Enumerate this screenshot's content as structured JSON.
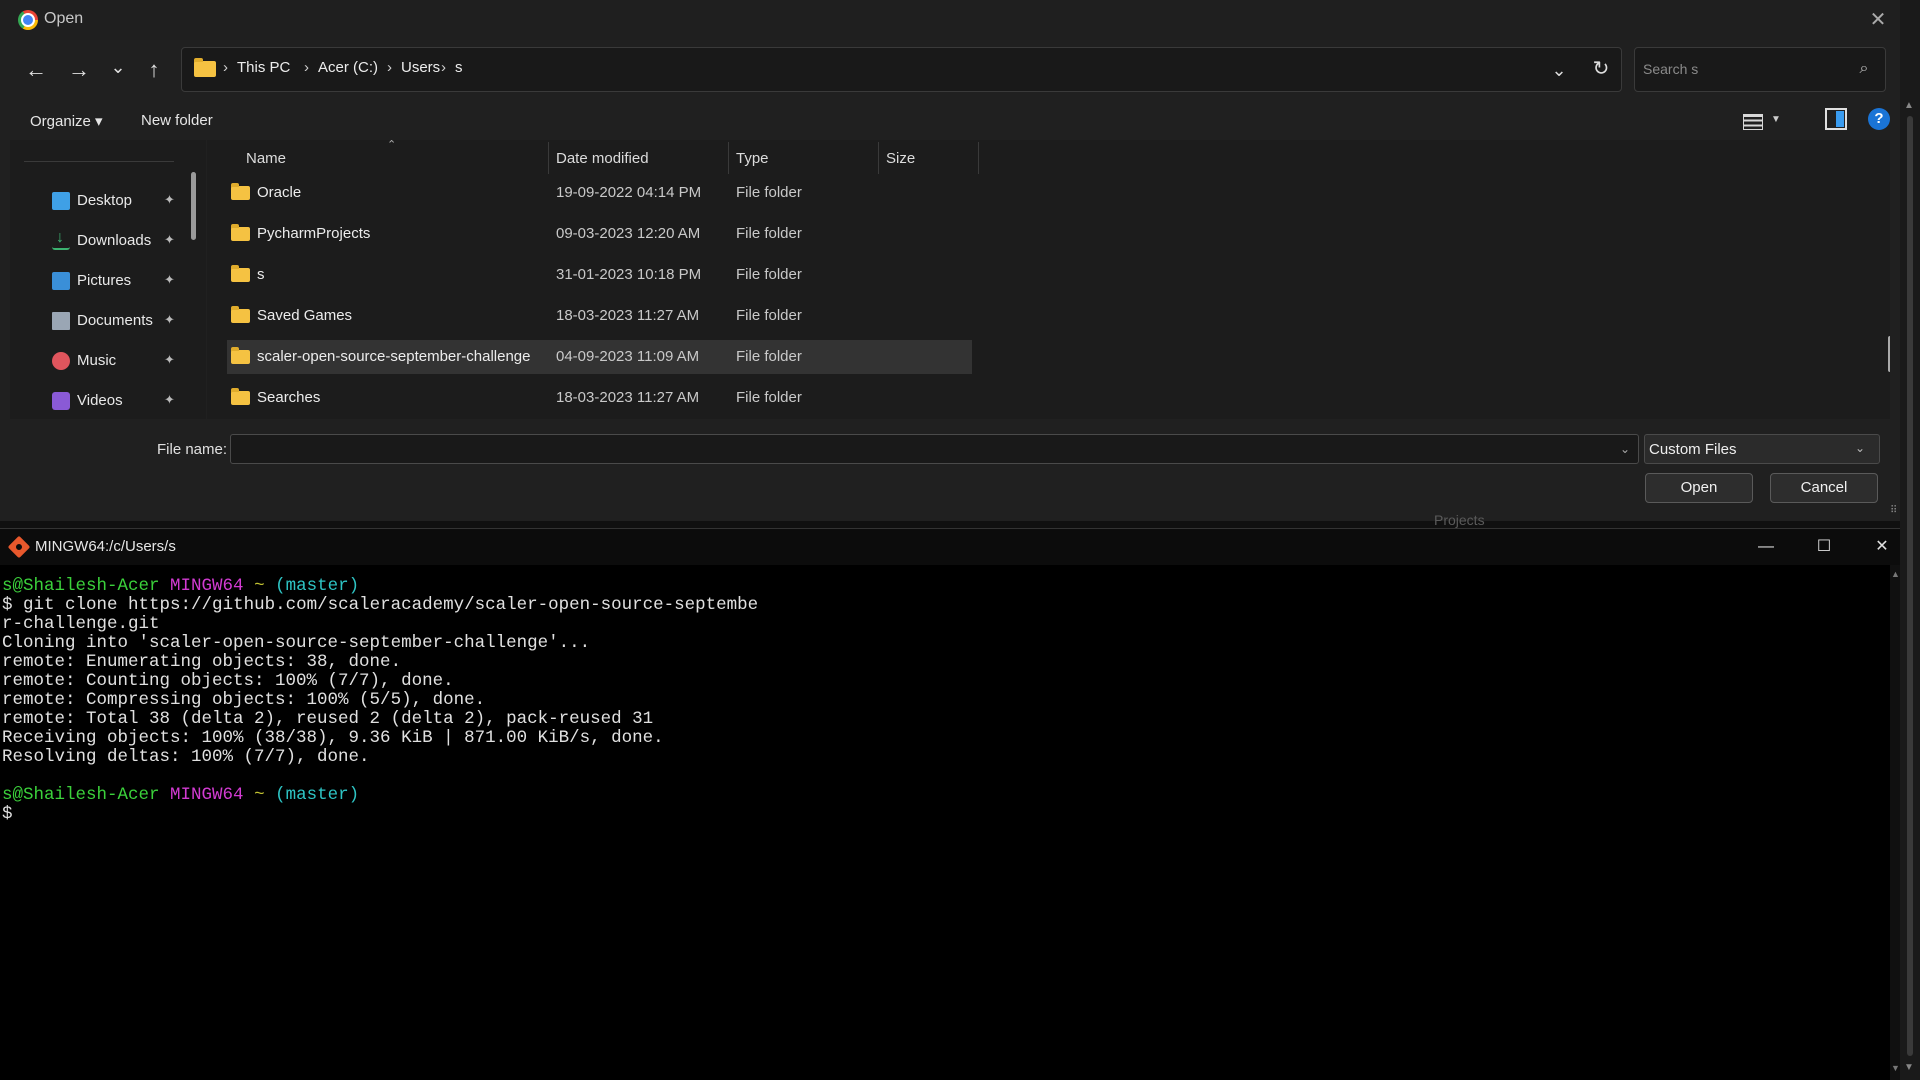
{
  "dialog": {
    "title": "Open",
    "close_glyph": "✕",
    "nav": {
      "back_glyph": "←",
      "forward_glyph": "→",
      "recent_glyph": "⌄",
      "up_glyph": "↑"
    },
    "address": {
      "breadcrumbs": [
        "This PC",
        "Acer (C:)",
        "Users",
        "s"
      ],
      "separator": "›",
      "dropdown_glyph": "⌄",
      "refresh_glyph": "↻"
    },
    "search": {
      "placeholder": "Search s",
      "icon_glyph": "⌕"
    },
    "toolbar": {
      "organize_label": "Organize ▾",
      "new_folder_label": "New folder",
      "help_label": "?"
    },
    "nav_pane": {
      "pin_glyph": "📌",
      "items": [
        {
          "label": "Desktop",
          "icon": "desktop-icon",
          "color": "#3fa0e6"
        },
        {
          "label": "Downloads",
          "icon": "download-icon",
          "color": "#3cb371"
        },
        {
          "label": "Pictures",
          "icon": "pictures-icon",
          "color": "#3a8fd8"
        },
        {
          "label": "Documents",
          "icon": "documents-icon",
          "color": "#9aa6b4"
        },
        {
          "label": "Music",
          "icon": "music-icon",
          "color": "#e0555d"
        },
        {
          "label": "Videos",
          "icon": "videos-icon",
          "color": "#8a5ad6"
        }
      ]
    },
    "columns": {
      "name": "Name",
      "date": "Date modified",
      "type": "Type",
      "size": "Size"
    },
    "sort_glyph": "⌃",
    "files": [
      {
        "name": "Oracle",
        "date": "19-09-2022 04:14 PM",
        "type": "File folder",
        "selected": false
      },
      {
        "name": "PycharmProjects",
        "date": "09-03-2023 12:20 AM",
        "type": "File folder",
        "selected": false
      },
      {
        "name": "s",
        "date": "31-01-2023 10:18 PM",
        "type": "File folder",
        "selected": false
      },
      {
        "name": "Saved Games",
        "date": "18-03-2023 11:27 AM",
        "type": "File folder",
        "selected": false
      },
      {
        "name": "scaler-open-source-september-challenge",
        "date": "04-09-2023 11:09 AM",
        "type": "File folder",
        "selected": true
      },
      {
        "name": "Searches",
        "date": "18-03-2023 11:27 AM",
        "type": "File folder",
        "selected": false
      }
    ],
    "filename": {
      "label": "File name:",
      "value": "",
      "dropdown_glyph": "⌄"
    },
    "filetype": {
      "value": "Custom Files",
      "caret_glyph": "⌄"
    },
    "buttons": {
      "open": "Open",
      "cancel": "Cancel"
    },
    "behind_window_text": "Projects"
  },
  "terminal": {
    "title": "MINGW64:/c/Users/s",
    "controls": {
      "minimize": "—",
      "maximize": "☐",
      "close": "✕"
    },
    "prompt": {
      "user": "s@Shailesh-Acer",
      "env": "MINGW64",
      "path": "~",
      "branch": "(master)",
      "symbol": "$"
    },
    "command": "git clone https://github.com/scaleracademy/scaler-open-source-septembe",
    "command_wrap": "r-challenge.git",
    "output": [
      "Cloning into 'scaler-open-source-september-challenge'...",
      "remote: Enumerating objects: 38, done.",
      "remote: Counting objects: 100% (7/7), done.",
      "remote: Compressing objects: 100% (5/5), done.",
      "remote: Total 38 (delta 2), reused 2 (delta 2), pack-reused 31",
      "Receiving objects: 100% (38/38), 9.36 KiB | 871.00 KiB/s, done.",
      "Resolving deltas: 100% (7/7), done."
    ]
  },
  "colors": {
    "dialog_bg": "#202020",
    "selection": "#333333",
    "accent": "#1a74d6",
    "folder": "#f5c242",
    "prompt_user": "#3bd13b",
    "prompt_env": "#d23bd2",
    "prompt_path": "#c2c232",
    "prompt_branch": "#2ec4c4"
  }
}
